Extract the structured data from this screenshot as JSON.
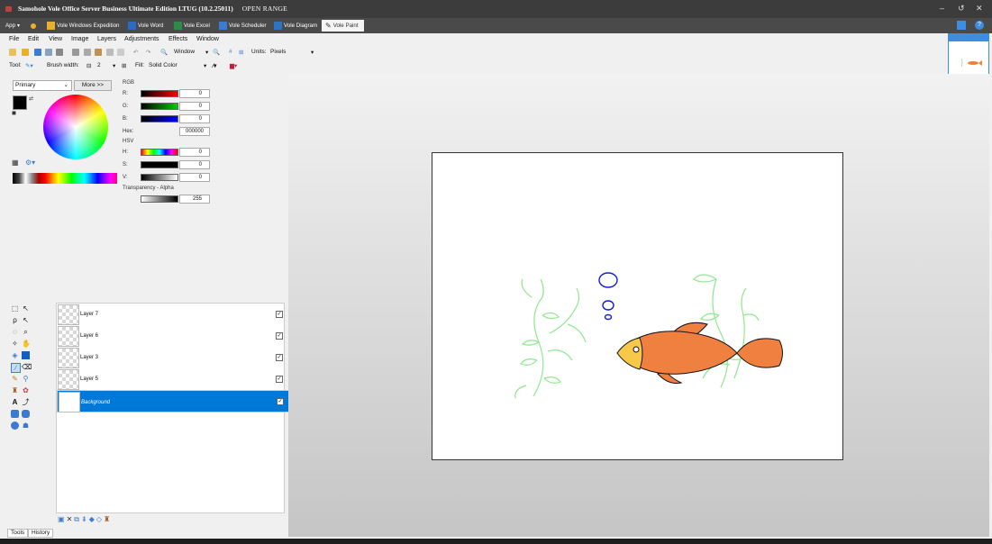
{
  "window": {
    "title": "Samohole Vole Office Server Business Ultimate Edition LTUG (10.2.25011)",
    "range_label": "OPEN RANGE",
    "controls": [
      "–",
      "↺",
      "✕"
    ]
  },
  "taskbar": {
    "app_label": "App",
    "tabs": [
      {
        "label": "Vole Windows Expedition",
        "color": "#e8b030"
      },
      {
        "label": "Vole Word",
        "color": "#2b6bc4"
      },
      {
        "label": "Vole Excel",
        "color": "#2e8b4a"
      },
      {
        "label": "Vole Scheduler",
        "color": "#3c7bd0"
      },
      {
        "label": "Vole Diagram",
        "color": "#2f74c0"
      },
      {
        "label": "Vole Paint",
        "color": "#6b6b6b",
        "active": true
      }
    ]
  },
  "menu": [
    "File",
    "Edit",
    "View",
    "Image",
    "Layers",
    "Adjustments",
    "Effects",
    "Window"
  ],
  "toolbar1": {
    "zoom_label": "Window",
    "units_label": "Units:",
    "units_value": "Pixels"
  },
  "toolbar2": {
    "tool_label": "Tool:",
    "brush_width_label": "Brush width:",
    "brush_width_value": "2",
    "fill_label": "Fill:",
    "fill_value": "Solid Color"
  },
  "colors": {
    "primary_select": "Primary",
    "more_button": "More >>",
    "rgb_label": "RGB",
    "r_label": "R:",
    "g_label": "G:",
    "b_label": "B:",
    "r_value": "0",
    "g_value": "0",
    "b_value": "0",
    "hex_label": "Hex:",
    "hex_value": "000000",
    "hsv_label": "HSV",
    "h_label": "H:",
    "s_label": "S:",
    "v_label": "V:",
    "h_value": "0",
    "s_value": "0",
    "v_value": "0",
    "alpha_label": "Transparency - Alpha",
    "alpha_value": "255"
  },
  "layers": [
    {
      "name": "Layer 7",
      "visible": true
    },
    {
      "name": "Layer 6",
      "visible": true
    },
    {
      "name": "Layer 3",
      "visible": true
    },
    {
      "name": "Layer 5",
      "visible": true
    },
    {
      "name": "Background",
      "visible": true,
      "selected": true
    }
  ],
  "bottom_tabs": [
    "Tools",
    "History"
  ],
  "accent": "#0078d7"
}
